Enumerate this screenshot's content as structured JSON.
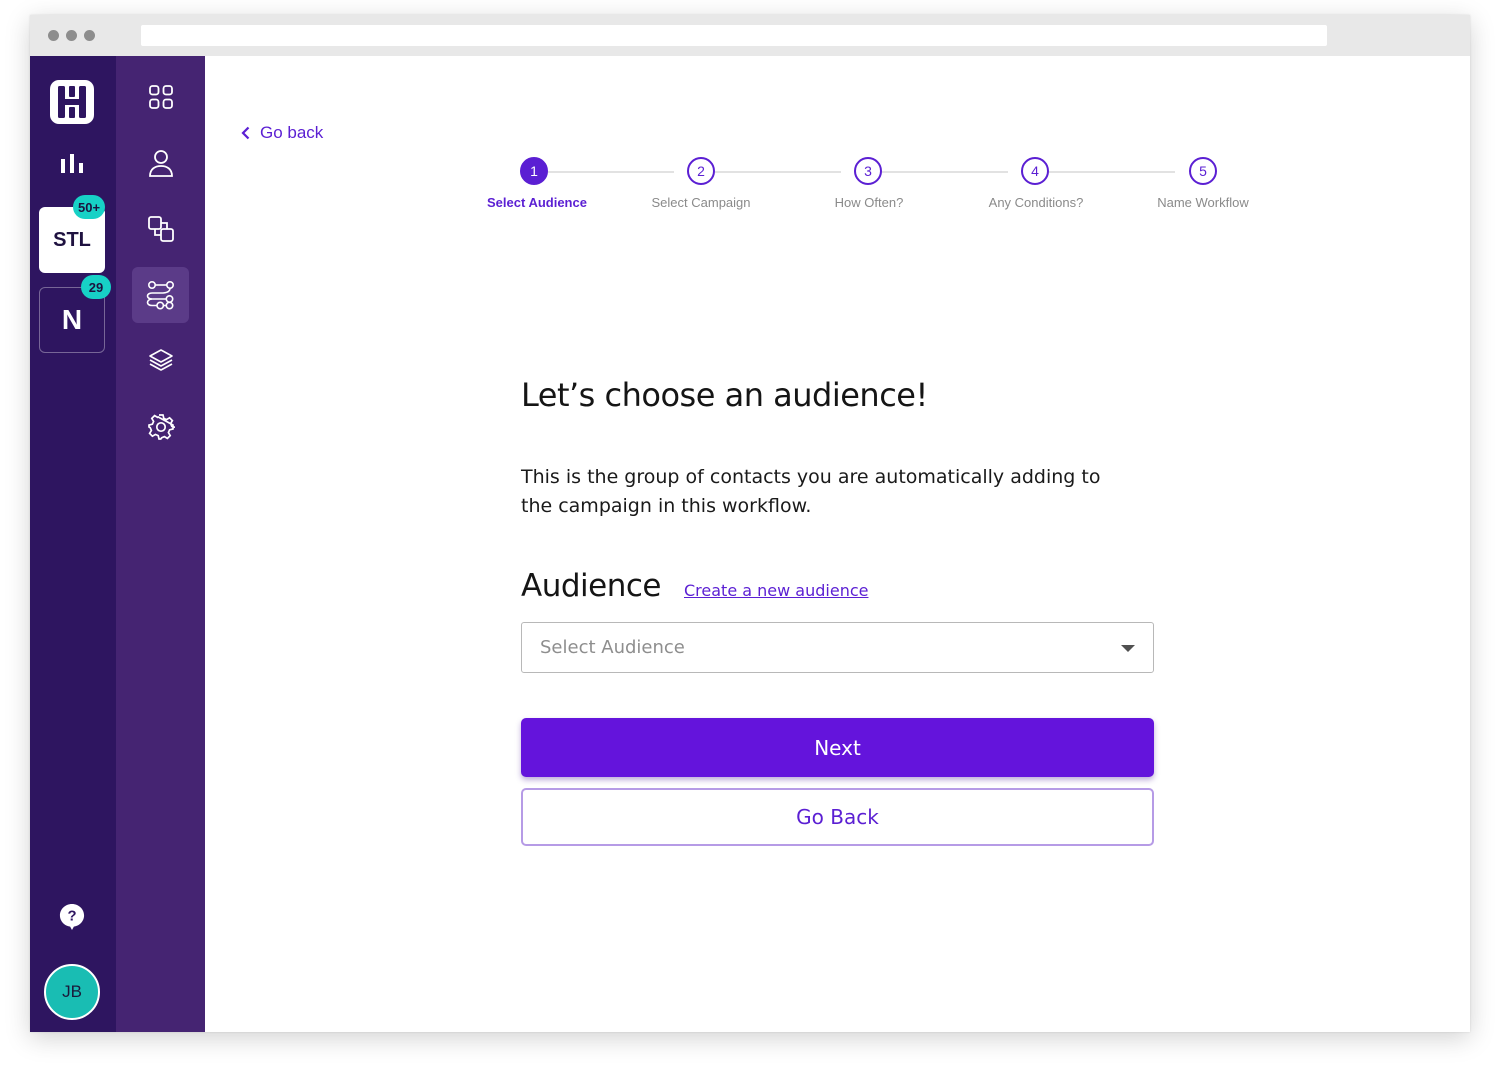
{
  "window": {
    "title": ""
  },
  "rail": {
    "logo": "hive-logo",
    "items": [
      {
        "name": "analytics",
        "icon": "bar-chart-icon"
      }
    ],
    "workspaces": [
      {
        "label": "STL",
        "badge": "50+",
        "active": true
      },
      {
        "label": "N",
        "badge": "29",
        "active": false
      }
    ],
    "help_icon": "question-icon",
    "avatar_initials": "JB"
  },
  "subnav": {
    "items": [
      {
        "name": "dashboard",
        "icon": "grid-icon",
        "active": false
      },
      {
        "name": "contacts",
        "icon": "user-icon",
        "active": false
      },
      {
        "name": "campaigns",
        "icon": "shapes-icon",
        "active": false
      },
      {
        "name": "workflows",
        "icon": "workflow-icon",
        "active": true
      },
      {
        "name": "integrations",
        "icon": "layers-icon",
        "active": false
      },
      {
        "name": "settings",
        "icon": "gear-icon",
        "active": false
      }
    ]
  },
  "nav": {
    "go_back": "Go back"
  },
  "stepper": {
    "steps": [
      {
        "number": "1",
        "label": "Select Audience",
        "active": true
      },
      {
        "number": "2",
        "label": "Select Campaign",
        "active": false
      },
      {
        "number": "3",
        "label": "How Often?",
        "active": false
      },
      {
        "number": "4",
        "label": "Any Conditions?",
        "active": false
      },
      {
        "number": "5",
        "label": "Name Workflow",
        "active": false
      }
    ]
  },
  "content": {
    "heading": "Let’s choose an audience!",
    "description": "This is the group of contacts you are automatically adding to the campaign in this workflow.",
    "audience_label": "Audience",
    "create_link": "Create a new audience",
    "select_placeholder": "Select Audience",
    "next_button": "Next",
    "go_back_button": "Go Back"
  },
  "colors": {
    "rail": "#2e1560",
    "subnav": "#452472",
    "accent": "#6414dc",
    "badge": "#17d1c6",
    "avatar": "#19bdb3"
  }
}
